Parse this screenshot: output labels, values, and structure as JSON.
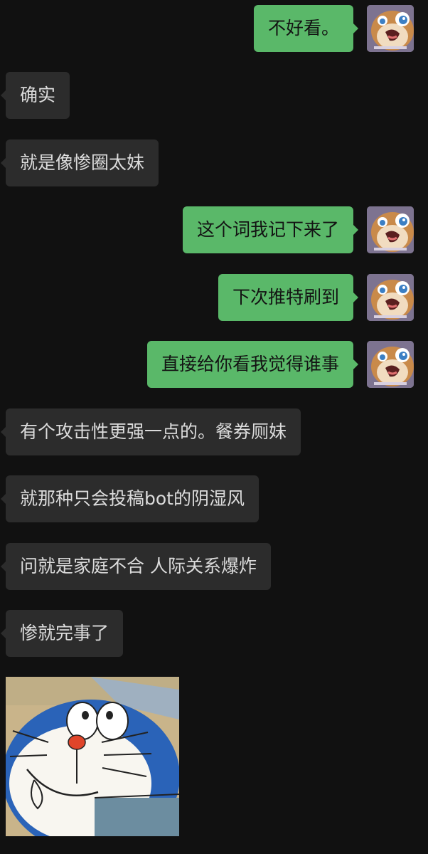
{
  "messages": [
    {
      "side": "right",
      "text": "不好看。"
    },
    {
      "side": "left",
      "text": "确实"
    },
    {
      "side": "left",
      "text": "就是像惨圈太妹"
    },
    {
      "side": "right",
      "text": "这个词我记下来了"
    },
    {
      "side": "right",
      "text": "下次推特刷到"
    },
    {
      "side": "right",
      "text": "直接给你看我觉得谁事"
    },
    {
      "side": "left",
      "text": "有个攻击性更强一点的。餐券厕妹"
    },
    {
      "side": "left",
      "text": "就那种只会投稿bot的阴湿风"
    },
    {
      "side": "left",
      "text": "问就是家庭不合 人际关系爆炸"
    },
    {
      "side": "left",
      "text": "惨就完事了"
    }
  ],
  "icons": {
    "my_avatar": "cartoon-crying-avatar-icon",
    "sticker": "doraemon-sticker"
  },
  "colors": {
    "background": "#111111",
    "incoming_bubble": "#2c2c2c",
    "outgoing_bubble": "#5ab869"
  }
}
